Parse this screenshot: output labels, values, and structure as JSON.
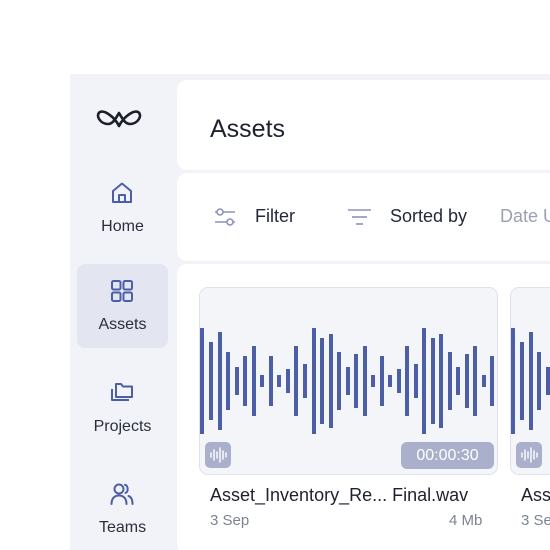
{
  "sidebar": {
    "logo": "infinity-heart-logo",
    "items": [
      {
        "label": "Home",
        "icon": "home-icon"
      },
      {
        "label": "Assets",
        "icon": "grid-icon",
        "active": true
      },
      {
        "label": "Projects",
        "icon": "folders-icon"
      },
      {
        "label": "Teams",
        "icon": "users-icon"
      }
    ]
  },
  "header": {
    "title": "Assets"
  },
  "toolbar": {
    "filter_label": "Filter",
    "sort_label": "Sorted by",
    "sort_value": "Date U"
  },
  "assets": [
    {
      "name": "Asset_Inventory_Re... Final.wav",
      "date": "3 Sep",
      "size": "4 Mb",
      "duration": "00:00:30"
    },
    {
      "name": "Ass",
      "date": "3 Se",
      "size": "",
      "duration": ""
    }
  ],
  "colors": {
    "accent": "#4c5fa6",
    "badge": "#aab0cc",
    "sidebar_bg": "#f2f3f8",
    "active_nav_bg": "#e3e6f0"
  }
}
